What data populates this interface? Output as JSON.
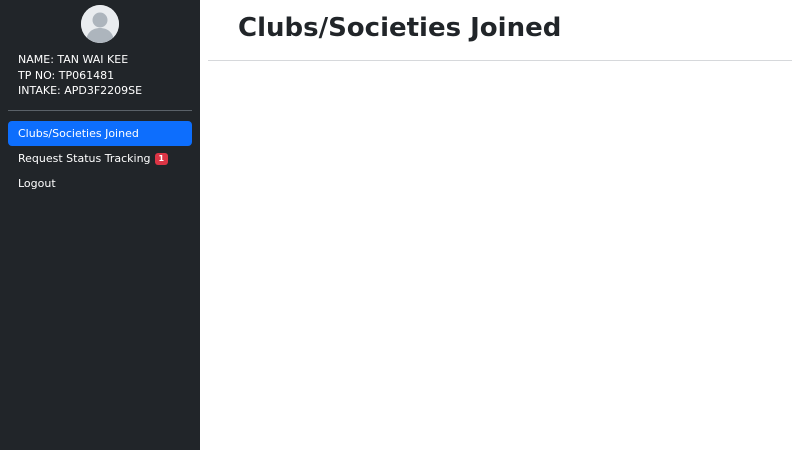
{
  "user": {
    "name_line": "NAME: TAN WAI KEE",
    "tp_line": "TP NO: TP061481",
    "intake_line": "INTAKE: APD3F2209SE"
  },
  "sidebar": {
    "items": [
      {
        "label": "Clubs/Societies Joined",
        "active": true
      },
      {
        "label": "Request Status Tracking",
        "badge": "1"
      },
      {
        "label": "Logout"
      }
    ]
  },
  "main": {
    "title": "Clubs/Societies Joined"
  },
  "colors": {
    "sidebar_bg": "#212529",
    "active_item": "#0d6efd",
    "badge": "#dc3545"
  }
}
